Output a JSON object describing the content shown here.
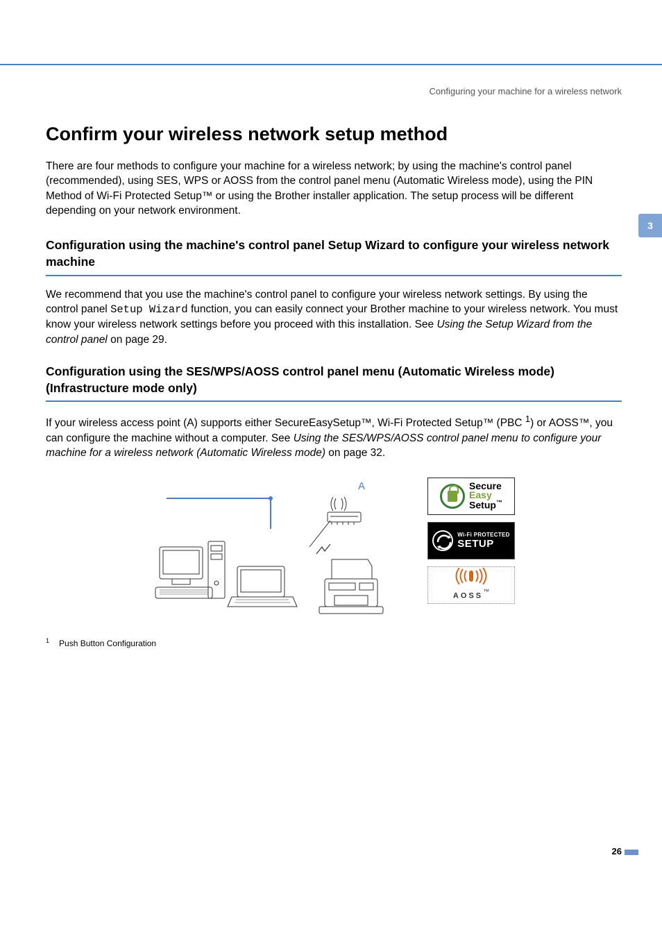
{
  "running_head": "Configuring your machine for a wireless network",
  "chapter_number": "3",
  "page_number": "26",
  "title": "Confirm your wireless network setup method",
  "intro": "There are four methods to configure your machine for a wireless network; by using the machine's control panel (recommended), using SES, WPS or AOSS from the control panel menu (Automatic Wireless mode), using the PIN Method of Wi-Fi Protected Setup™ or using the Brother installer application. The setup process will be different depending on your network environment.",
  "section1": {
    "heading": "Configuration using the machine's control panel Setup Wizard to configure your wireless network machine",
    "para_a": "We recommend that you use the machine's control panel to configure your wireless network settings. By using the control panel ",
    "mono": "Setup Wizard",
    "para_b": " function, you can easily connect your Brother machine to your wireless network. You must know your wireless network settings before you proceed with this installation. See ",
    "link": "Using the Setup Wizard from the control panel",
    "para_c": " on page 29."
  },
  "section2": {
    "heading": "Configuration using the SES/WPS/AOSS control panel menu (Automatic Wireless mode) (Infrastructure mode only)",
    "para_a": "If your wireless access point (A) supports either SecureEasySetup™, Wi-Fi Protected Setup™ (PBC ",
    "sup1": "1",
    "para_b": ") or AOSS™, you can configure the machine without a computer. See ",
    "link": "Using the SES/WPS/AOSS control panel menu to configure your machine for a wireless network (Automatic Wireless mode)",
    "para_c": " on page 32."
  },
  "diagram": {
    "label_A": "A",
    "ses": {
      "line1": "Secure",
      "line2": "Easy",
      "line3": "Setup",
      "tm": "™"
    },
    "wps": {
      "line1": "Wi-Fi PROTECTED",
      "line2": "SETUP"
    },
    "aoss": {
      "icon": "((( | )))",
      "label": "AOSS",
      "tm": "™"
    }
  },
  "footnote": {
    "num": "1",
    "text": "Push Button Configuration"
  }
}
